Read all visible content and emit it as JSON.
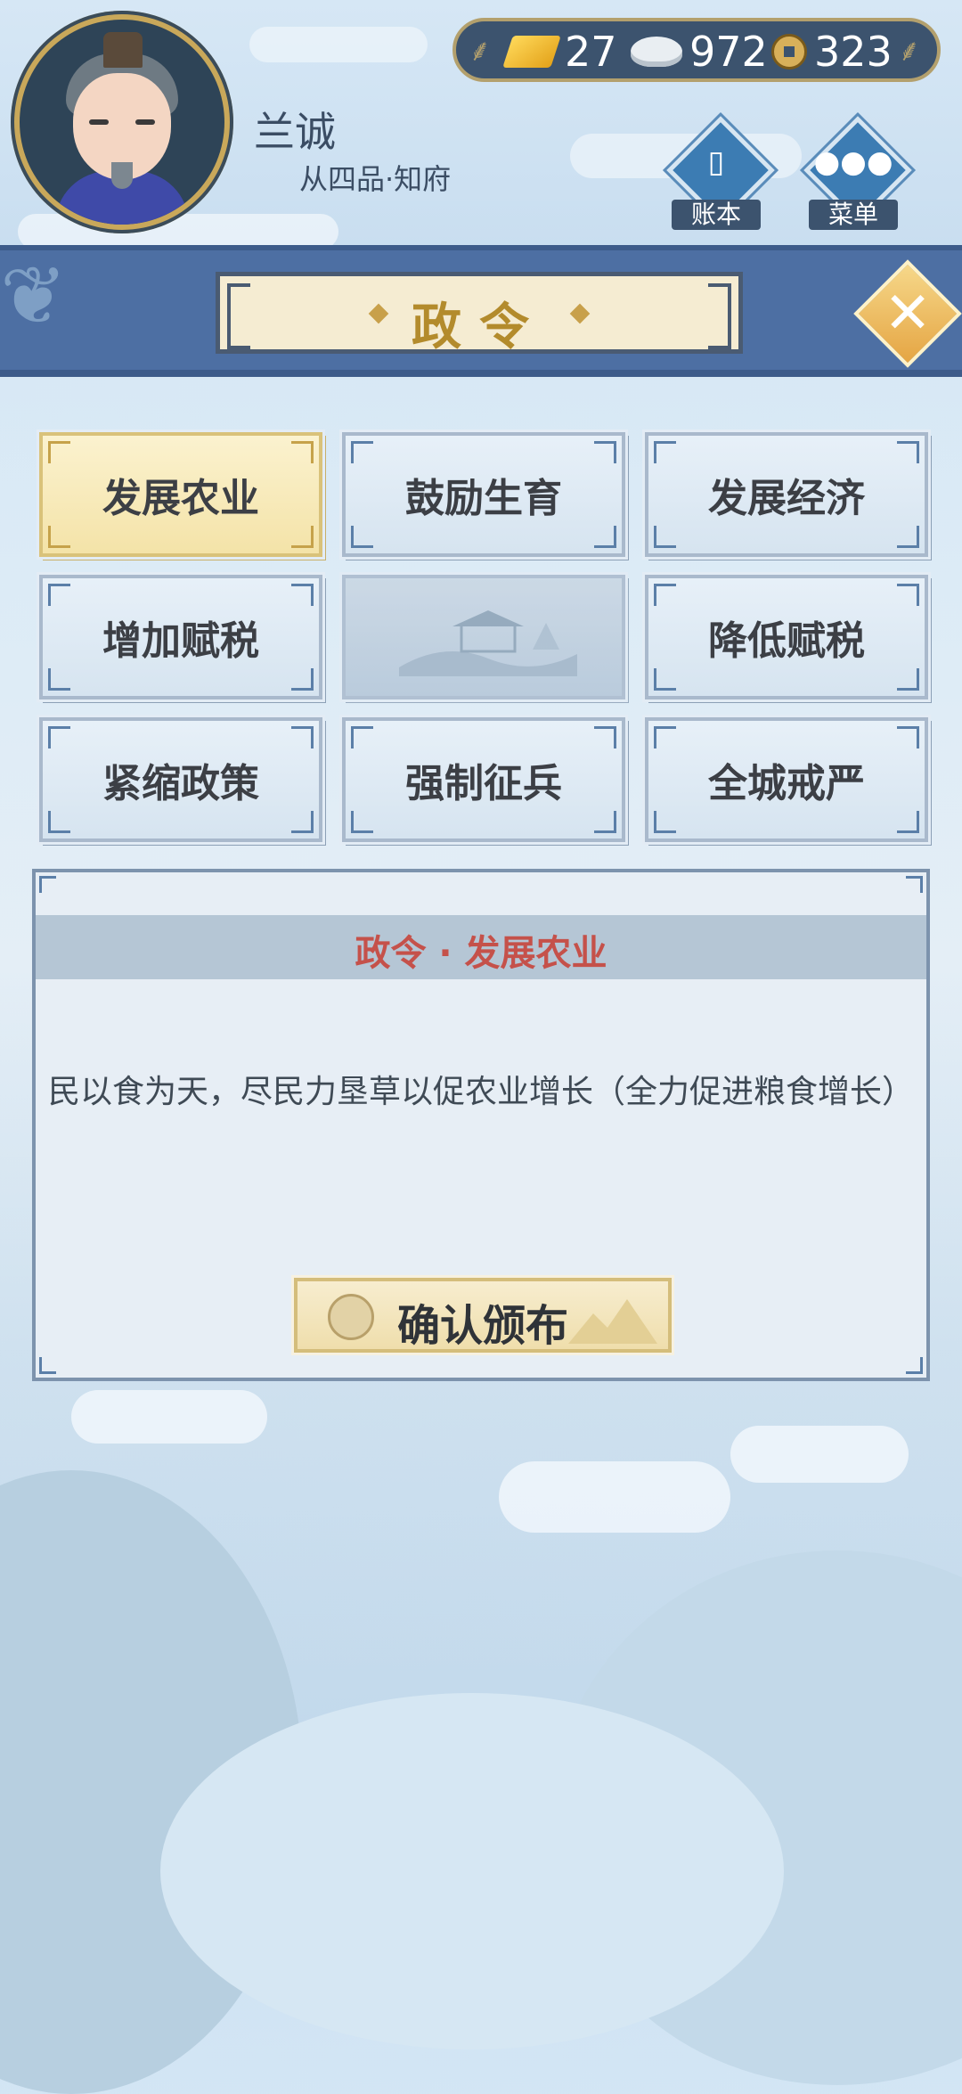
{
  "player": {
    "name": "兰诚",
    "rank": "从四品·知府"
  },
  "currency": {
    "gold": "27",
    "silver": "972",
    "coin": "323"
  },
  "nav": {
    "ledger_label": "账本",
    "menu_label": "菜单"
  },
  "screen_title": "政令",
  "policies": [
    {
      "label": "发展农业",
      "state": "selected"
    },
    {
      "label": "鼓励生育",
      "state": "normal"
    },
    {
      "label": "发展经济",
      "state": "normal"
    },
    {
      "label": "增加赋税",
      "state": "normal"
    },
    {
      "label": "",
      "state": "locked"
    },
    {
      "label": "降低赋税",
      "state": "normal"
    },
    {
      "label": "紧缩政策",
      "state": "normal"
    },
    {
      "label": "强制征兵",
      "state": "normal"
    },
    {
      "label": "全城戒严",
      "state": "normal"
    }
  ],
  "detail": {
    "title": "政令 · 发展农业",
    "description": "民以食为天，尽民力垦草以促农业增长（全力促进粮食增长）",
    "confirm_label": "确认颁布"
  },
  "colors": {
    "accent_red": "#c5514a",
    "gold": "#b38b2c",
    "banner_blue": "#4d6fa3"
  }
}
